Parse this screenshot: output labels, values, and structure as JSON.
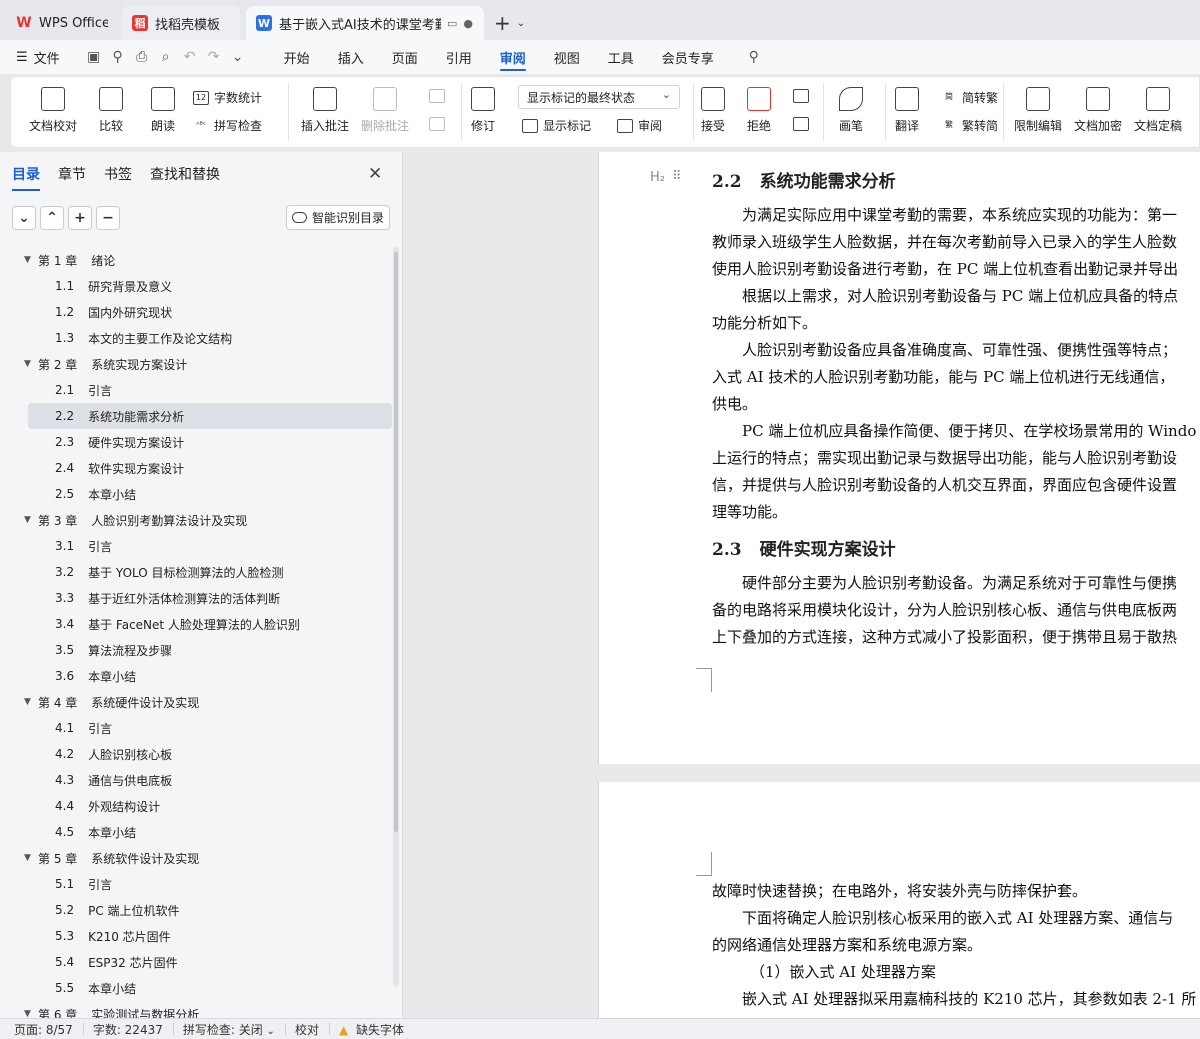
{
  "tabs": [
    {
      "label": "WPS Office",
      "icon": "wps-logo-icon"
    },
    {
      "label": "找稻壳模板",
      "icon": "docer-icon"
    },
    {
      "label": "基于嵌入式AI技术的课堂考勤系统",
      "icon": "writer-doc-icon"
    }
  ],
  "menu": {
    "file": "文件",
    "items": [
      "开始",
      "插入",
      "页面",
      "引用",
      "审阅",
      "视图",
      "工具",
      "会员专享"
    ],
    "active": "审阅"
  },
  "ribbon": {
    "doc_proofread": "文档校对",
    "compare": "比较",
    "read_aloud": "朗读",
    "word_count": "字数统计",
    "spell_check": "拼写检查",
    "insert_comment": "插入批注",
    "delete_comment": "删除批注",
    "revise": "修订",
    "markup_state": "显示标记的最终状态",
    "show_markup": "显示标记",
    "review": "审阅",
    "accept": "接受",
    "reject": "拒绝",
    "pen": "画笔",
    "translate": "翻译",
    "trad_simp": "繁转简",
    "simp_trad": "简转繁",
    "restrict_edit": "限制编辑",
    "encrypt": "文档加密",
    "finalize": "文档定稿"
  },
  "nav": {
    "tabs": [
      "目录",
      "章节",
      "书签",
      "查找和替换"
    ],
    "active_tab": "目录",
    "smart_toc": "智能识别目录",
    "toc": [
      {
        "level": 1,
        "num": "第 1 章",
        "text": "绪论"
      },
      {
        "level": 2,
        "num": "1.1",
        "text": "研究背景及意义"
      },
      {
        "level": 2,
        "num": "1.2",
        "text": "国内外研究现状"
      },
      {
        "level": 2,
        "num": "1.3",
        "text": "本文的主要工作及论文结构"
      },
      {
        "level": 1,
        "num": "第 2 章",
        "text": "系统实现方案设计"
      },
      {
        "level": 2,
        "num": "2.1",
        "text": "引言"
      },
      {
        "level": 2,
        "num": "2.2",
        "text": "系统功能需求分析",
        "selected": true
      },
      {
        "level": 2,
        "num": "2.3",
        "text": "硬件实现方案设计"
      },
      {
        "level": 2,
        "num": "2.4",
        "text": "软件实现方案设计"
      },
      {
        "level": 2,
        "num": "2.5",
        "text": "本章小结"
      },
      {
        "level": 1,
        "num": "第 3 章",
        "text": "人脸识别考勤算法设计及实现"
      },
      {
        "level": 2,
        "num": "3.1",
        "text": "引言"
      },
      {
        "level": 2,
        "num": "3.2",
        "text": "基于 YOLO 目标检测算法的人脸检测"
      },
      {
        "level": 2,
        "num": "3.3",
        "text": "基于近红外活体检测算法的活体判断"
      },
      {
        "level": 2,
        "num": "3.4",
        "text": "基于 FaceNet 人脸处理算法的人脸识别"
      },
      {
        "level": 2,
        "num": "3.5",
        "text": "算法流程及步骤"
      },
      {
        "level": 2,
        "num": "3.6",
        "text": "本章小结"
      },
      {
        "level": 1,
        "num": "第 4 章",
        "text": "系统硬件设计及实现"
      },
      {
        "level": 2,
        "num": "4.1",
        "text": "引言"
      },
      {
        "level": 2,
        "num": "4.2",
        "text": "人脸识别核心板"
      },
      {
        "level": 2,
        "num": "4.3",
        "text": "通信与供电底板"
      },
      {
        "level": 2,
        "num": "4.4",
        "text": "外观结构设计"
      },
      {
        "level": 2,
        "num": "4.5",
        "text": "本章小结"
      },
      {
        "level": 1,
        "num": "第 5 章",
        "text": "系统软件设计及实现"
      },
      {
        "level": 2,
        "num": "5.1",
        "text": "引言"
      },
      {
        "level": 2,
        "num": "5.2",
        "text": "PC 端上位机软件"
      },
      {
        "level": 2,
        "num": "5.3",
        "text": "K210 芯片固件"
      },
      {
        "level": 2,
        "num": "5.4",
        "text": "ESP32 芯片固件"
      },
      {
        "level": 2,
        "num": "5.5",
        "text": "本章小结"
      },
      {
        "level": 1,
        "num": "第 6 章",
        "text": "实验测试与数据分析"
      }
    ]
  },
  "doc": {
    "heading_mark": "H₂",
    "h_22": {
      "num": "2.2",
      "text": "系统功能需求分析"
    },
    "h_23": {
      "num": "2.3",
      "text": "硬件实现方案设计"
    },
    "p1": [
      "为满足实际应用中课堂考勤的需要，本系统应实现的功能为：第一",
      "教师录入班级学生人脸数据，并在每次考勤前导入已录入的学生人脸数",
      "使用人脸识别考勤设备进行考勤，在 PC 端上位机查看出勤记录并导出"
    ],
    "p2": [
      "根据以上需求，对人脸识别考勤设备与 PC 端上位机应具备的特点",
      "功能分析如下。"
    ],
    "p3": [
      "人脸识别考勤设备应具备准确度高、可靠性强、便携性强等特点；",
      "入式 AI 技术的人脸识别考勤功能，能与 PC 端上位机进行无线通信，",
      "供电。"
    ],
    "p4": [
      "PC 端上位机应具备操作简便、便于拷贝、在学校场景常用的 Windo",
      "上运行的特点；需实现出勤记录与数据导出功能，能与人脸识别考勤设",
      "信，并提供与人脸识别考勤设备的人机交互界面，界面应包含硬件设置",
      "理等功能。"
    ],
    "p5": [
      "硬件部分主要为人脸识别考勤设备。为满足系统对于可靠性与便携",
      "备的电路将采用模块化设计，分为人脸识别核心板、通信与供电底板两",
      "上下叠加的方式连接，这种方式减小了投影面积，便于携带且易于散热"
    ],
    "page2": [
      "故障时快速替换；在电路外，将安装外壳与防摔保护套。",
      "下面将确定人脸识别核心板采用的嵌入式 AI 处理器方案、通信与",
      "的网络通信处理器方案和系统电源方案。",
      "（1）嵌入式 AI 处理器方案",
      "嵌入式 AI 处理器拟采用嘉楠科技的 K210 芯片，其参数如表 2-1 所"
    ]
  },
  "status": {
    "page": "页面: 8/57",
    "words": "字数: 22437",
    "spell": "拼写检查: 关闭",
    "proof": "校对",
    "missing_font": "缺失字体"
  }
}
